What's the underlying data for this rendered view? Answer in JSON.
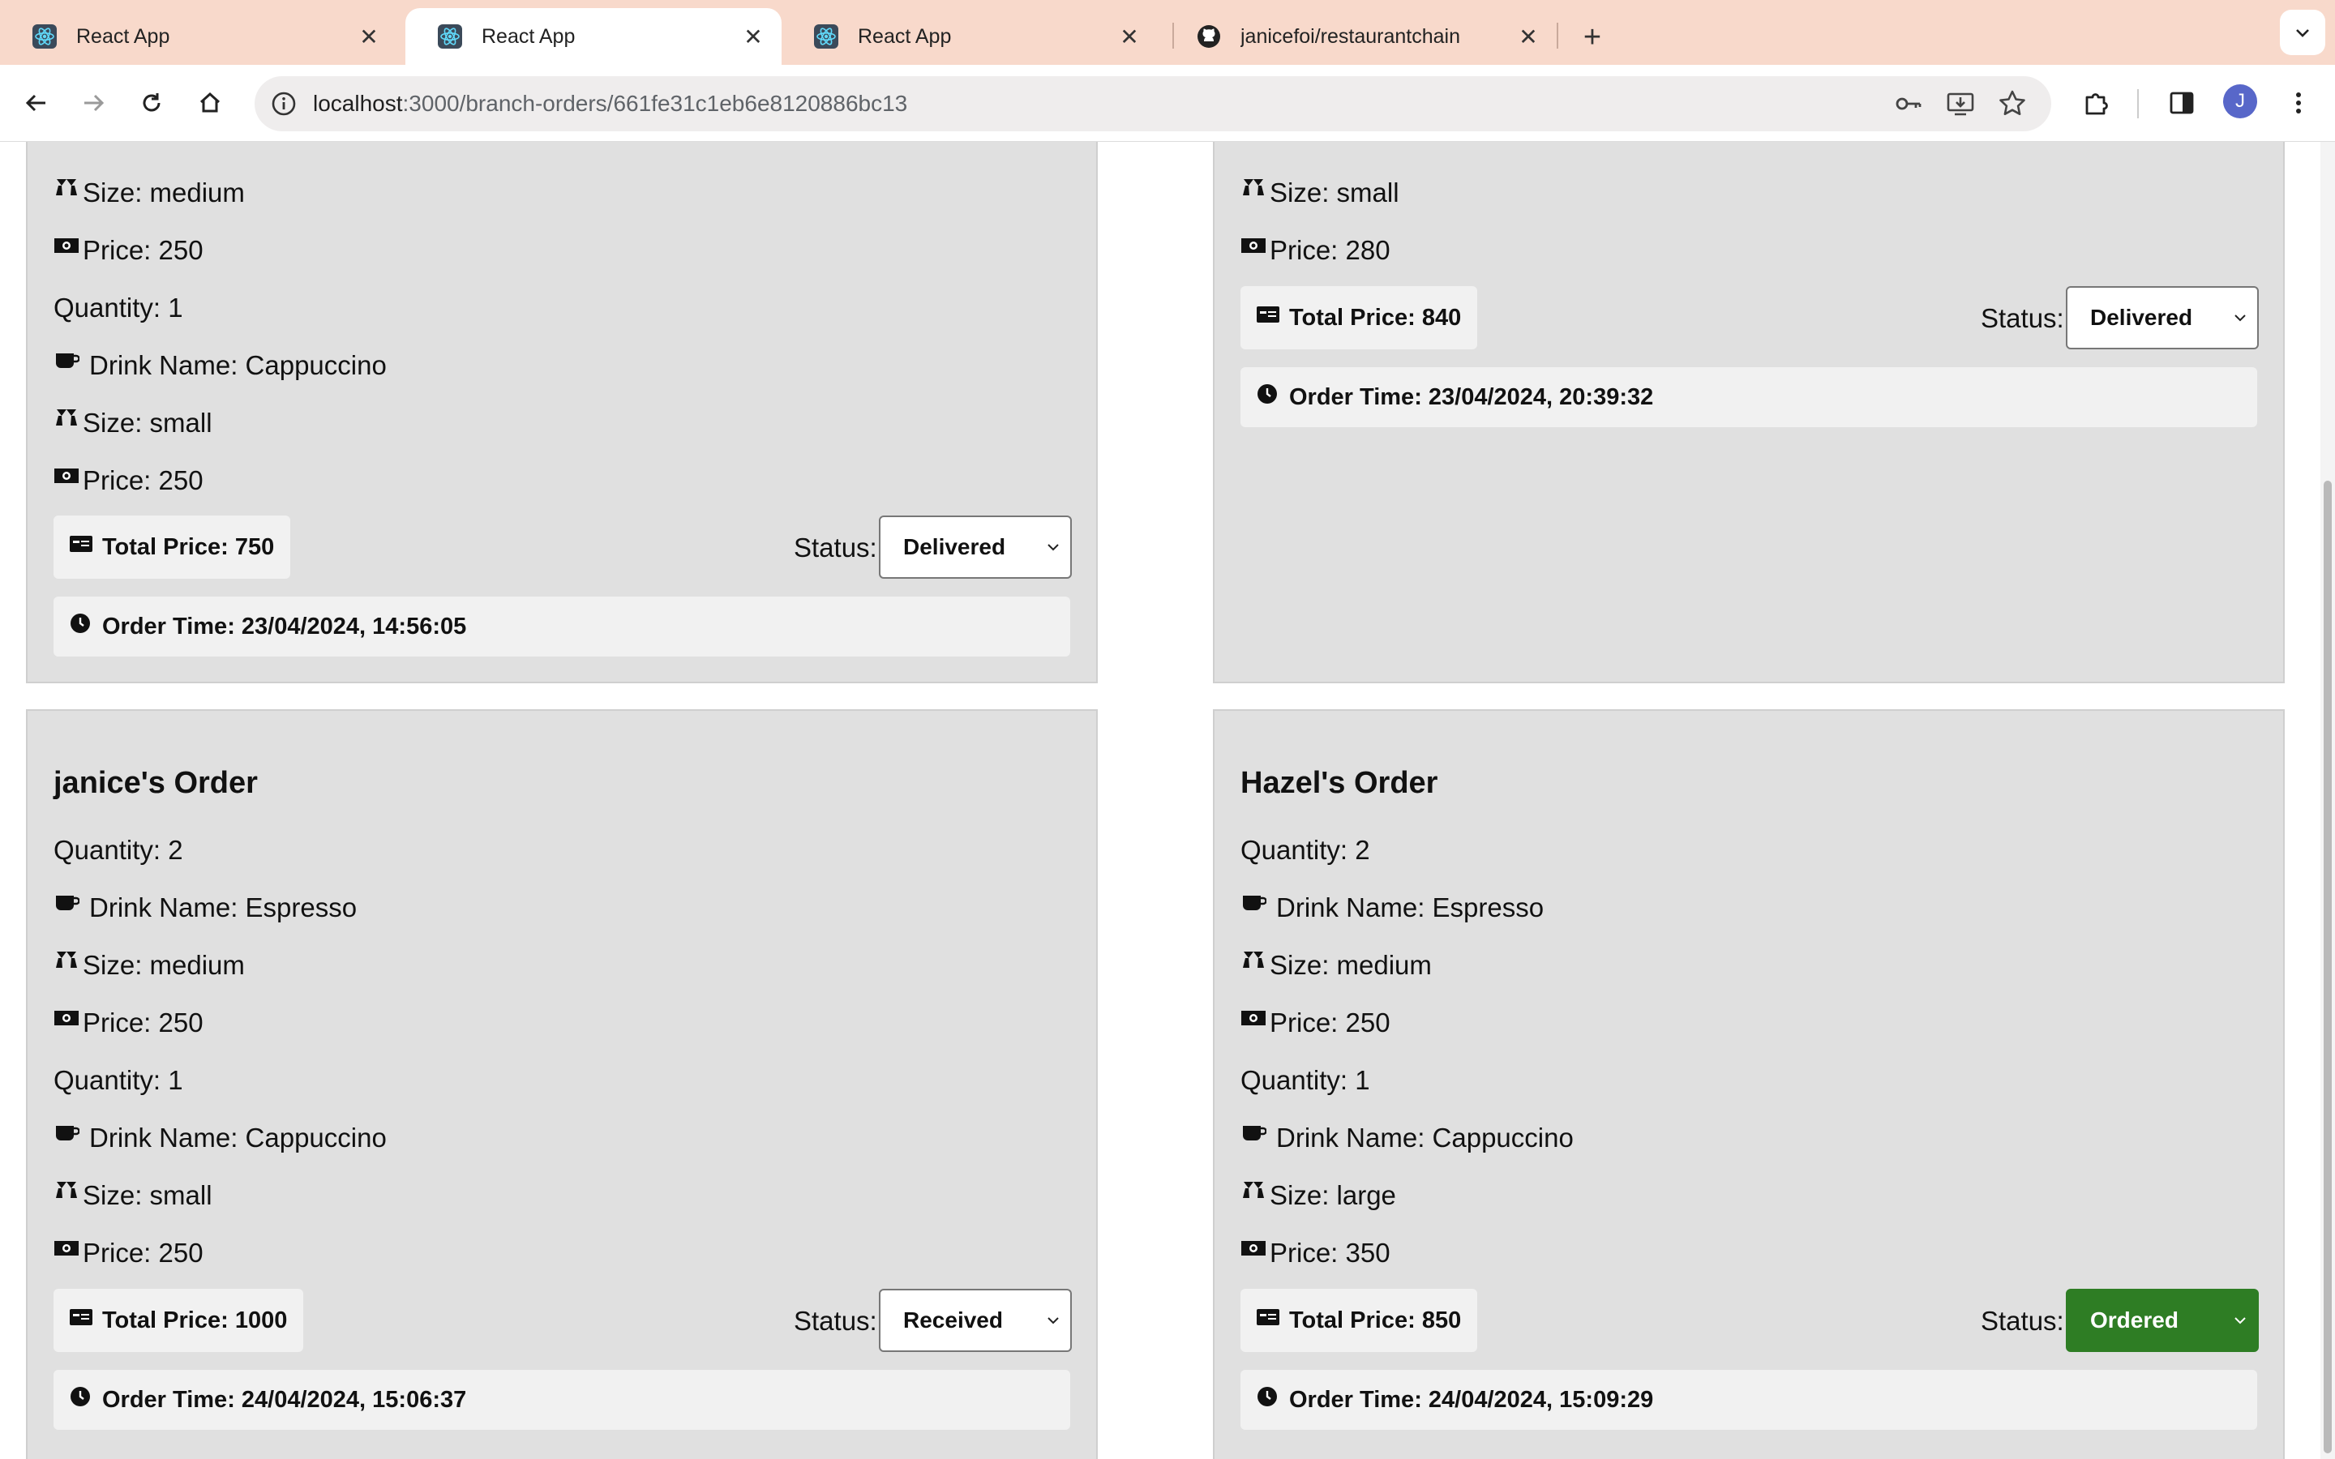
{
  "browser": {
    "tabs": [
      {
        "title": "React App",
        "icon": "react-icon"
      },
      {
        "title": "React App",
        "icon": "react-icon",
        "active": true
      },
      {
        "title": "React App",
        "icon": "react-icon"
      },
      {
        "title": "janicefoi/restaurantchain",
        "icon": "github-icon"
      }
    ],
    "url_host": "localhost",
    "url_path": ":3000/branch-orders/661fe31c1eb6e8120886bc13",
    "profile_initial": "J"
  },
  "orders": [
    {
      "title": "",
      "items": [
        {
          "size": "Size: medium",
          "price": "Price: 250"
        },
        {
          "quantity": "Quantity: 1",
          "drink": "Drink Name: Cappuccino",
          "size": "Size: small",
          "price": "Price: 250"
        }
      ],
      "total": "Total Price: 750",
      "status_label": "Status:",
      "status": "Delivered",
      "order_time": "Order Time: 23/04/2024, 14:56:05"
    },
    {
      "title": "",
      "items": [
        {
          "size": "Size: small",
          "price": "Price: 280"
        }
      ],
      "total": "Total Price: 840",
      "status_label": "Status:",
      "status": "Delivered",
      "order_time": "Order Time: 23/04/2024, 20:39:32"
    },
    {
      "title": "janice's Order",
      "items": [
        {
          "quantity": "Quantity: 2",
          "drink": "Drink Name: Espresso",
          "size": "Size: medium",
          "price": "Price: 250"
        },
        {
          "quantity": "Quantity: 1",
          "drink": "Drink Name: Cappuccino",
          "size": "Size: small",
          "price": "Price: 250"
        }
      ],
      "total": "Total Price: 1000",
      "status_label": "Status:",
      "status": "Received",
      "order_time": "Order Time: 24/04/2024, 15:06:37"
    },
    {
      "title": "Hazel's Order",
      "items": [
        {
          "quantity": "Quantity: 2",
          "drink": "Drink Name: Espresso",
          "size": "Size: medium",
          "price": "Price: 250"
        },
        {
          "quantity": "Quantity: 1",
          "drink": "Drink Name: Cappuccino",
          "size": "Size: large",
          "price": "Price: 350"
        }
      ],
      "total": "Total Price: 850",
      "status_label": "Status:",
      "status": "Ordered",
      "status_color": "#2e7d24",
      "order_time": "Order Time: 24/04/2024, 15:09:29"
    }
  ]
}
